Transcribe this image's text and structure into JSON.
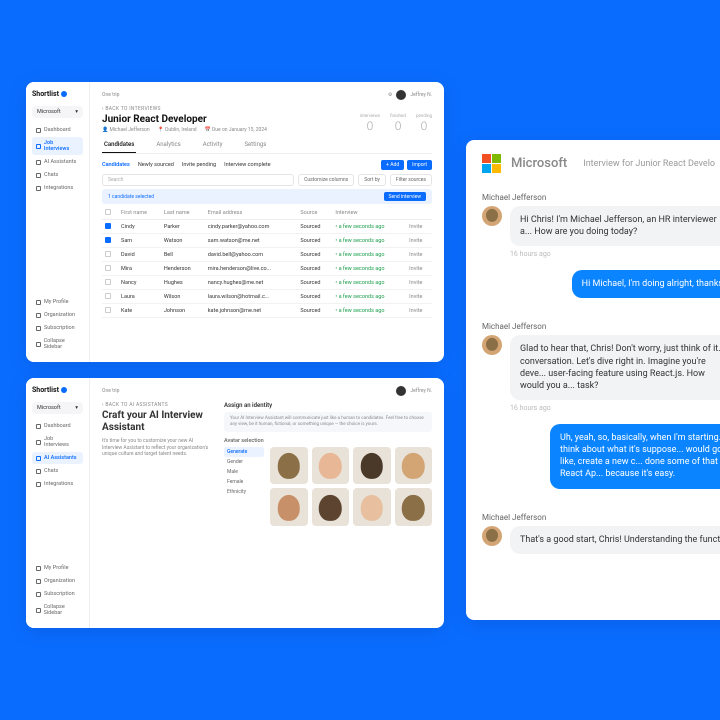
{
  "brand": "Shortlist",
  "org": "Microsoft",
  "user": "Jeffrey N.",
  "sidebar": {
    "items": [
      {
        "label": "Dashboard"
      },
      {
        "label": "Job Interviews"
      },
      {
        "label": "AI Assistants"
      },
      {
        "label": "Chats"
      },
      {
        "label": "Integrations"
      }
    ],
    "bottom": [
      {
        "label": "My Profile"
      },
      {
        "label": "Organization"
      },
      {
        "label": "Subscription"
      },
      {
        "label": "Collapse Sidebar"
      }
    ]
  },
  "panel1": {
    "back": "BACK TO INTERVIEWS",
    "title": "Junior React Developer",
    "owner": "Michael Jefferson",
    "location": "Dublin, Ireland",
    "due": "Due on January 15, 2024",
    "stats": [
      {
        "label": "interviews",
        "value": "0"
      },
      {
        "label": "finished",
        "value": "0"
      },
      {
        "label": "pending",
        "value": "0"
      }
    ],
    "tabs": [
      "Candidates",
      "Analytics",
      "Activity",
      "Settings"
    ],
    "subtabs": {
      "a": "Candidates",
      "b": "Newly sourced",
      "c": "Invite pending",
      "d": "Interview complete"
    },
    "actions": {
      "add": "+ Add",
      "import": "Import"
    },
    "search_placeholder": "Search",
    "filters": {
      "a": "Customize columns",
      "b": "Sort by",
      "c": "Filter sources"
    },
    "selection": "1 candidate selected",
    "sel_action": "Send interview",
    "columns": [
      "",
      "First name",
      "Last name",
      "Email address",
      "Source",
      "Interview",
      ""
    ],
    "rows": [
      {
        "checked": true,
        "first": "Cindy",
        "last": "Parker",
        "email": "cindy.parker@yahoo.com",
        "source": "Sourced",
        "status": "a few seconds ago",
        "action": "Invite"
      },
      {
        "checked": true,
        "first": "Sam",
        "last": "Watson",
        "email": "sam.watson@me.net",
        "source": "Sourced",
        "status": "a few seconds ago",
        "action": "Invite"
      },
      {
        "checked": false,
        "first": "David",
        "last": "Bell",
        "email": "david.bell@yahoo.com",
        "source": "Sourced",
        "status": "a few seconds ago",
        "action": "Invite"
      },
      {
        "checked": false,
        "first": "Mira",
        "last": "Henderson",
        "email": "mira.henderson@live.co...",
        "source": "Sourced",
        "status": "a few seconds ago",
        "action": "Invite"
      },
      {
        "checked": false,
        "first": "Nancy",
        "last": "Hughes",
        "email": "nancy.hughes@me.net",
        "source": "Sourced",
        "status": "a few seconds ago",
        "action": "Invite"
      },
      {
        "checked": false,
        "first": "Laura",
        "last": "Wilson",
        "email": "laura.wilson@hotmail.c...",
        "source": "Sourced",
        "status": "a few seconds ago",
        "action": "Invite"
      },
      {
        "checked": false,
        "first": "Kate",
        "last": "Johnson",
        "email": "kate.johnson@me.net",
        "source": "Sourced",
        "status": "a few seconds ago",
        "action": "Invite"
      }
    ]
  },
  "panel2": {
    "back": "BACK TO AI ASSISTANTS",
    "title": "Craft your AI Interview Assistant",
    "desc": "It's time for you to customize your new AI Interview Assistant to reflect your organization's unique culture and target talent needs.",
    "section": "Assign an identity",
    "hint": "Your AI Interview Assistant will communicate just like a human to candidates. Feel free to choose any view, be it human, fictional, or something unique — the choice is yours.",
    "avatar_heading": "Avatar selection",
    "generate": "Generate",
    "filters": [
      "Gender",
      "Male",
      "Female",
      "Ethnicity"
    ]
  },
  "panel3": {
    "company": "Microsoft",
    "subject": "Interview for Junior React Develo",
    "sender": "Michael Jefferson",
    "ts1": "16 hours ago",
    "msgs": {
      "m1": "Hi Chris! I'm Michael Jefferson, an HR interviewer a... How are you doing today?",
      "r1": "Hi Michael, I'm doing alright, thanks. A b... here.",
      "m2": "Glad to hear that, Chris! Don't worry, just think of it... conversation. Let's dive right in. Imagine you're deve... user-facing feature using React.js. How would you a... task?",
      "r2": "Uh, yeah, so, basically, when I'm starting... you know, think about what it's suppose... would go ahead and, like, create a new c... done some of that with Create React Ap... because it's easy.",
      "m3": "That's a good start, Chris! Understanding the funct..."
    }
  }
}
